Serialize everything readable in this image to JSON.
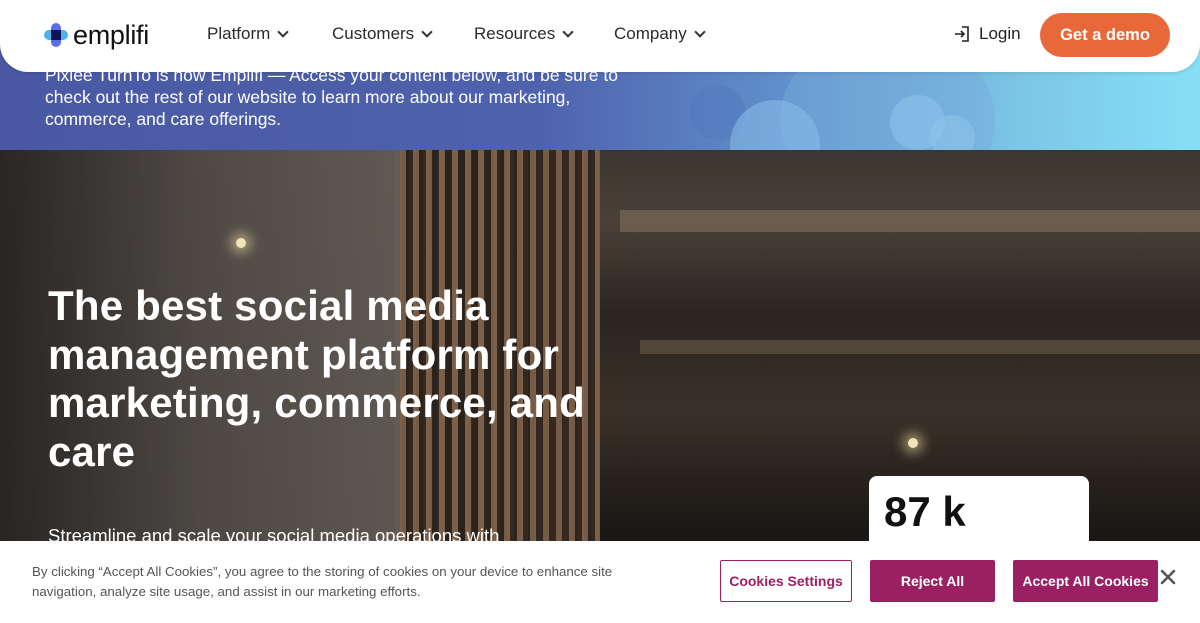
{
  "banner": {
    "text": "Pixlee TurnTo is now Emplifi — Access your content below, and be sure to check out the rest of our website to learn more about our marketing, commerce, and care offerings."
  },
  "navbar": {
    "logo_text": "emplifi",
    "items": [
      {
        "label": "Platform"
      },
      {
        "label": "Customers"
      },
      {
        "label": "Resources"
      },
      {
        "label": "Company"
      }
    ],
    "login_label": "Login",
    "demo_label": "Get a demo",
    "demo_color": "#e9683a"
  },
  "hero": {
    "headline": "The best social media management platform for marketing, commerce, and care",
    "subline": "Streamline and scale your social media operations with",
    "stat_value": "87 k"
  },
  "cookie": {
    "text": "By clicking “Accept All Cookies”, you agree to the storing of cookies on your device to enhance site navigation, analyze site usage, and assist in our marketing efforts.",
    "settings_label": "Cookies Settings",
    "reject_label": "Reject All",
    "accept_label": "Accept All Cookies",
    "accent_color": "#9b1f63"
  }
}
